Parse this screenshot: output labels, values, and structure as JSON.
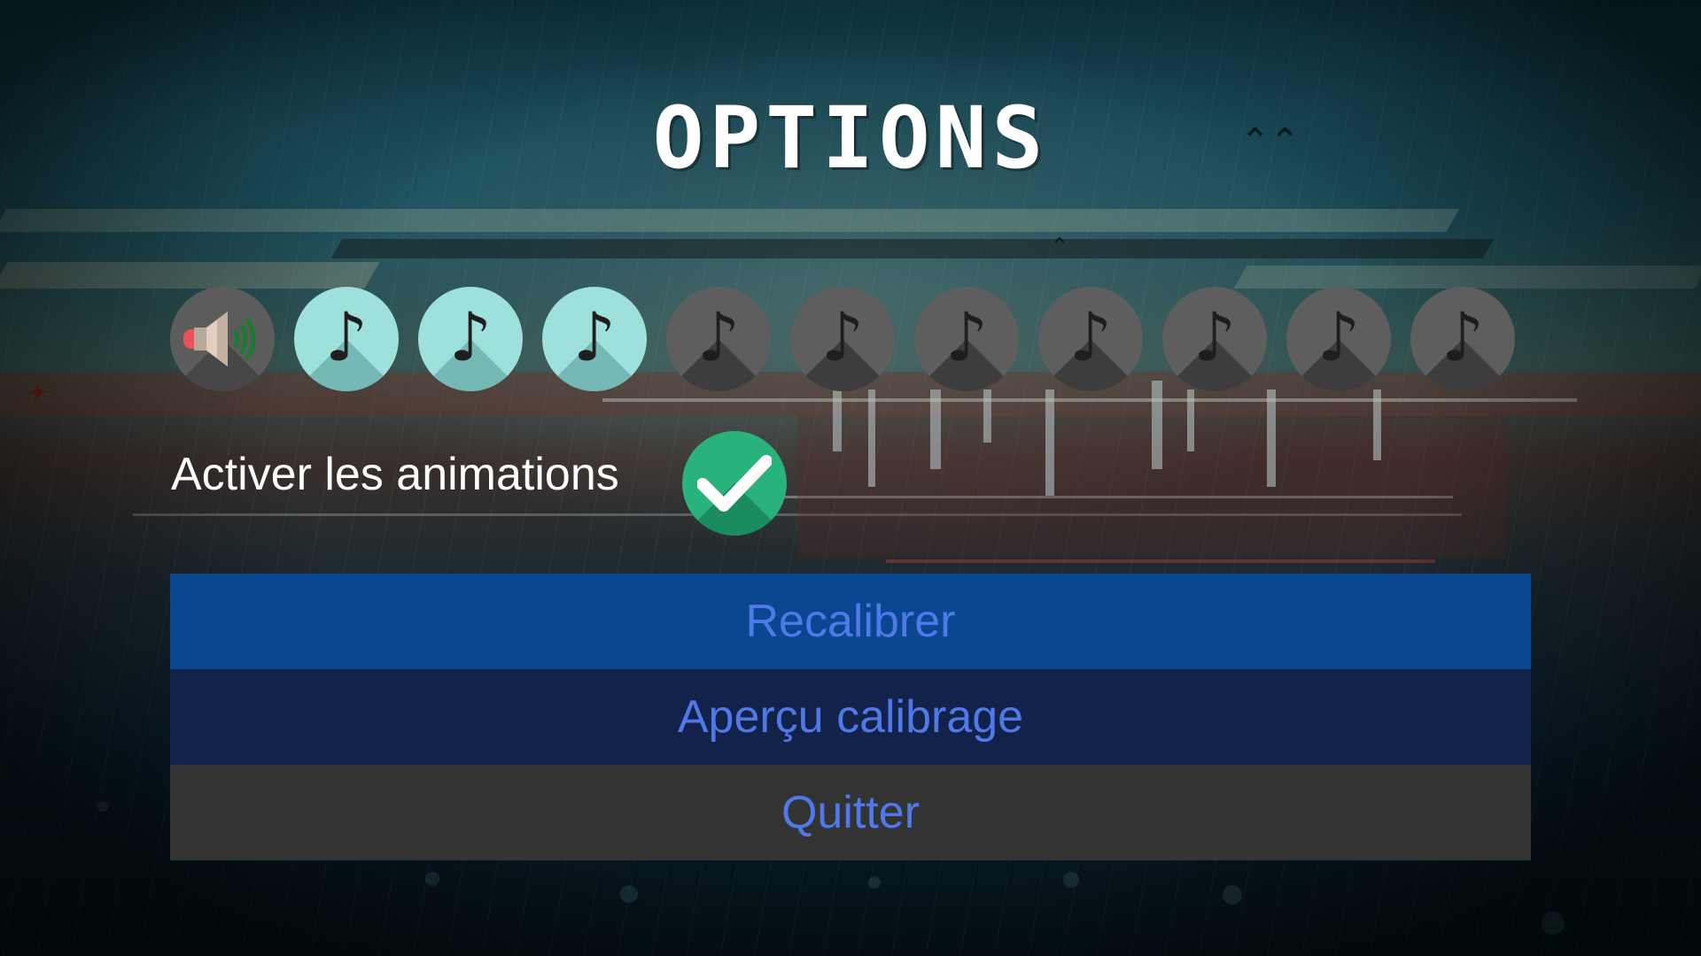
{
  "screen": {
    "title": "OPTIONS"
  },
  "volume": {
    "level": 3,
    "max": 10,
    "mute_icon": "speaker-icon",
    "step_icon": "music-note-icon",
    "step_glyph": "♪",
    "on_color": "#9ee0dc",
    "off_color": "#5e5e5e"
  },
  "animations": {
    "label": "Activer les animations",
    "enabled": true,
    "check_icon": "checkmark-icon",
    "check_color": "#2ab27b"
  },
  "menu": {
    "recalibrate_label": "Recalibrer",
    "preview_label": "Aperçu calibrage",
    "quit_label": "Quitter",
    "text_color": "#4f78e8",
    "recalibrate_bg": "#0b4690",
    "preview_bg": "#13224a",
    "quit_bg": "#333333"
  }
}
